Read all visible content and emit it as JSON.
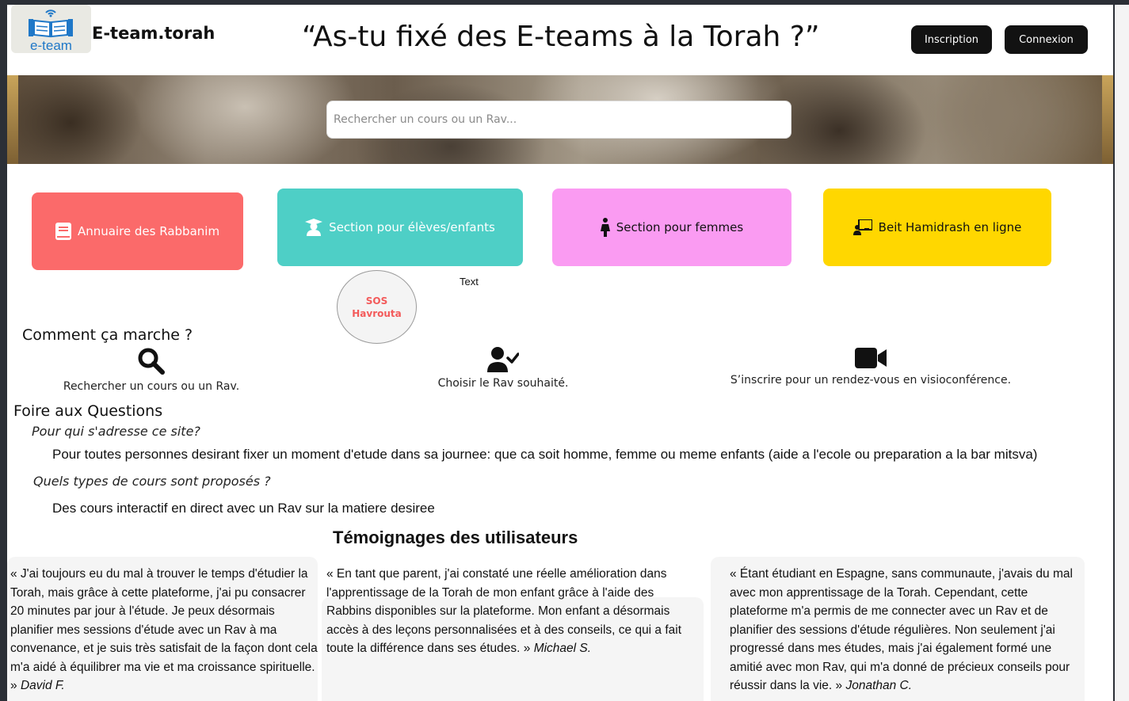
{
  "header": {
    "logo_text": "e-team",
    "site_name": "E-team.torah",
    "headline": "“As-tu fixé des E-teams à la Torah ?”",
    "inscription_label": "Inscription",
    "connexion_label": "Connexion"
  },
  "search": {
    "placeholder": "Rechercher un cours ou un Rav..."
  },
  "categories": [
    {
      "label": "Annuaire des Rabbanim",
      "icon": "book-icon",
      "color": "#fb6a6a"
    },
    {
      "label": "Section pour élèves/enfants",
      "icon": "graduate-icon",
      "color": "#4ecfc6"
    },
    {
      "label": "Section pour femmes",
      "icon": "woman-icon",
      "color": "#fa9bf2"
    },
    {
      "label": "Beit Hamidrash en ligne",
      "icon": "chalkboard-teacher-icon",
      "color": "#ffd700"
    }
  ],
  "sos": {
    "line1": "SOS",
    "line2": "Havrouta"
  },
  "text_label": "Text",
  "how_it_works": {
    "title": "Comment ça marche ?",
    "steps": [
      {
        "label": "Rechercher un cours ou un Rav.",
        "icon": "search-icon"
      },
      {
        "label": "Choisir le Rav souhaité.",
        "icon": "user-check-icon"
      },
      {
        "label": "S’inscrire pour un rendez-vous en visioconférence.",
        "icon": "video-icon"
      }
    ]
  },
  "faq": {
    "title": "Foire aux Questions",
    "items": [
      {
        "question": "Pour qui s'adresse ce site?",
        "answer": "Pour toutes personnes desirant fixer un moment d'etude dans sa journee: que ca soit homme, femme ou meme enfants (aide a l'ecole ou preparation a la bar mitsva)"
      },
      {
        "question": "Quels types de cours sont proposés ?",
        "answer": "Des cours interactif en direct avec un Rav sur la matiere desiree"
      }
    ]
  },
  "testimonials": {
    "title": "Témoignages des utilisateurs",
    "items": [
      {
        "text": "« J'ai toujours eu du mal à trouver le temps d'étudier la Torah, mais grâce à cette plateforme, j'ai pu consacrer 20 minutes par jour à l'étude. Je peux désormais planifier mes sessions d'étude avec un Rav à ma convenance, et je suis très satisfait de la façon dont cela m'a aidé à équilibrer ma vie et ma croissance spirituelle. »",
        "author": "David F."
      },
      {
        "text": "« En tant que parent, j'ai constaté une réelle amélioration dans l'apprentissage de la Torah de mon enfant grâce à l'aide des Rabbins disponibles sur la plateforme. Mon enfant a désormais accès à des leçons personnalisées et à des conseils, ce qui a fait toute la différence dans ses études. »",
        "author": "Michael S."
      },
      {
        "text": "« Étant étudiant en Espagne, sans communaute, j'avais du mal avec mon apprentissage de la Torah. Cependant, cette plateforme m'a permis de me connecter avec un Rav et de planifier des sessions d'étude régulières. Non seulement j'ai progressé dans mes études, mais j'ai également formé une amitié avec mon Rav, qui m'a donné de précieux conseils pour réussir dans la vie. »",
        "author": "Jonathan C."
      }
    ]
  }
}
